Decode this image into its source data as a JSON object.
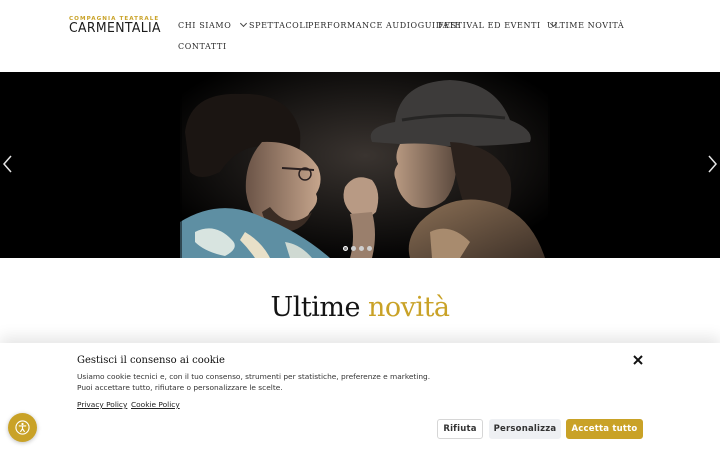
{
  "brand": {
    "tagline": "COMPAGNIA TEATRALE",
    "name": "CARMENTALIA",
    "accent_color": "#c9a227"
  },
  "nav": {
    "items": [
      {
        "label": "CHI SIAMO",
        "has_dropdown": true
      },
      {
        "label": "SPETTACOLI",
        "has_dropdown": false
      },
      {
        "label": "PERFORMANCE AUDIOGUIDATE",
        "has_dropdown": false
      },
      {
        "label": "FESTIVAL ED EVENTI",
        "has_dropdown": true
      },
      {
        "label": "ULTIME NOVITÀ",
        "has_dropdown": false
      },
      {
        "label": "CONTATTI",
        "has_dropdown": false
      }
    ]
  },
  "slider": {
    "prev_icon": "chevron-left-icon",
    "next_icon": "chevron-right-icon",
    "slide_count": 4,
    "active_slide": 1
  },
  "section": {
    "title_main": "Ultime",
    "title_accent": "novità"
  },
  "cookie": {
    "title": "Gestisci il consenso ai cookie",
    "text_line1": "Usiamo cookie tecnici e, con il tuo consenso, strumenti per statistiche, preferenze e marketing.",
    "text_line2": "Puoi accettare tutto, rifiutare o personalizzare le scelte.",
    "privacy_link": "Privacy Policy",
    "cookie_link": "Cookie Policy",
    "reject_label": "Rifiuta",
    "customize_label": "Personalizza",
    "accept_label": "Accetta tutto",
    "close_icon": "close-icon"
  },
  "accessibility": {
    "icon": "accessibility-icon"
  }
}
